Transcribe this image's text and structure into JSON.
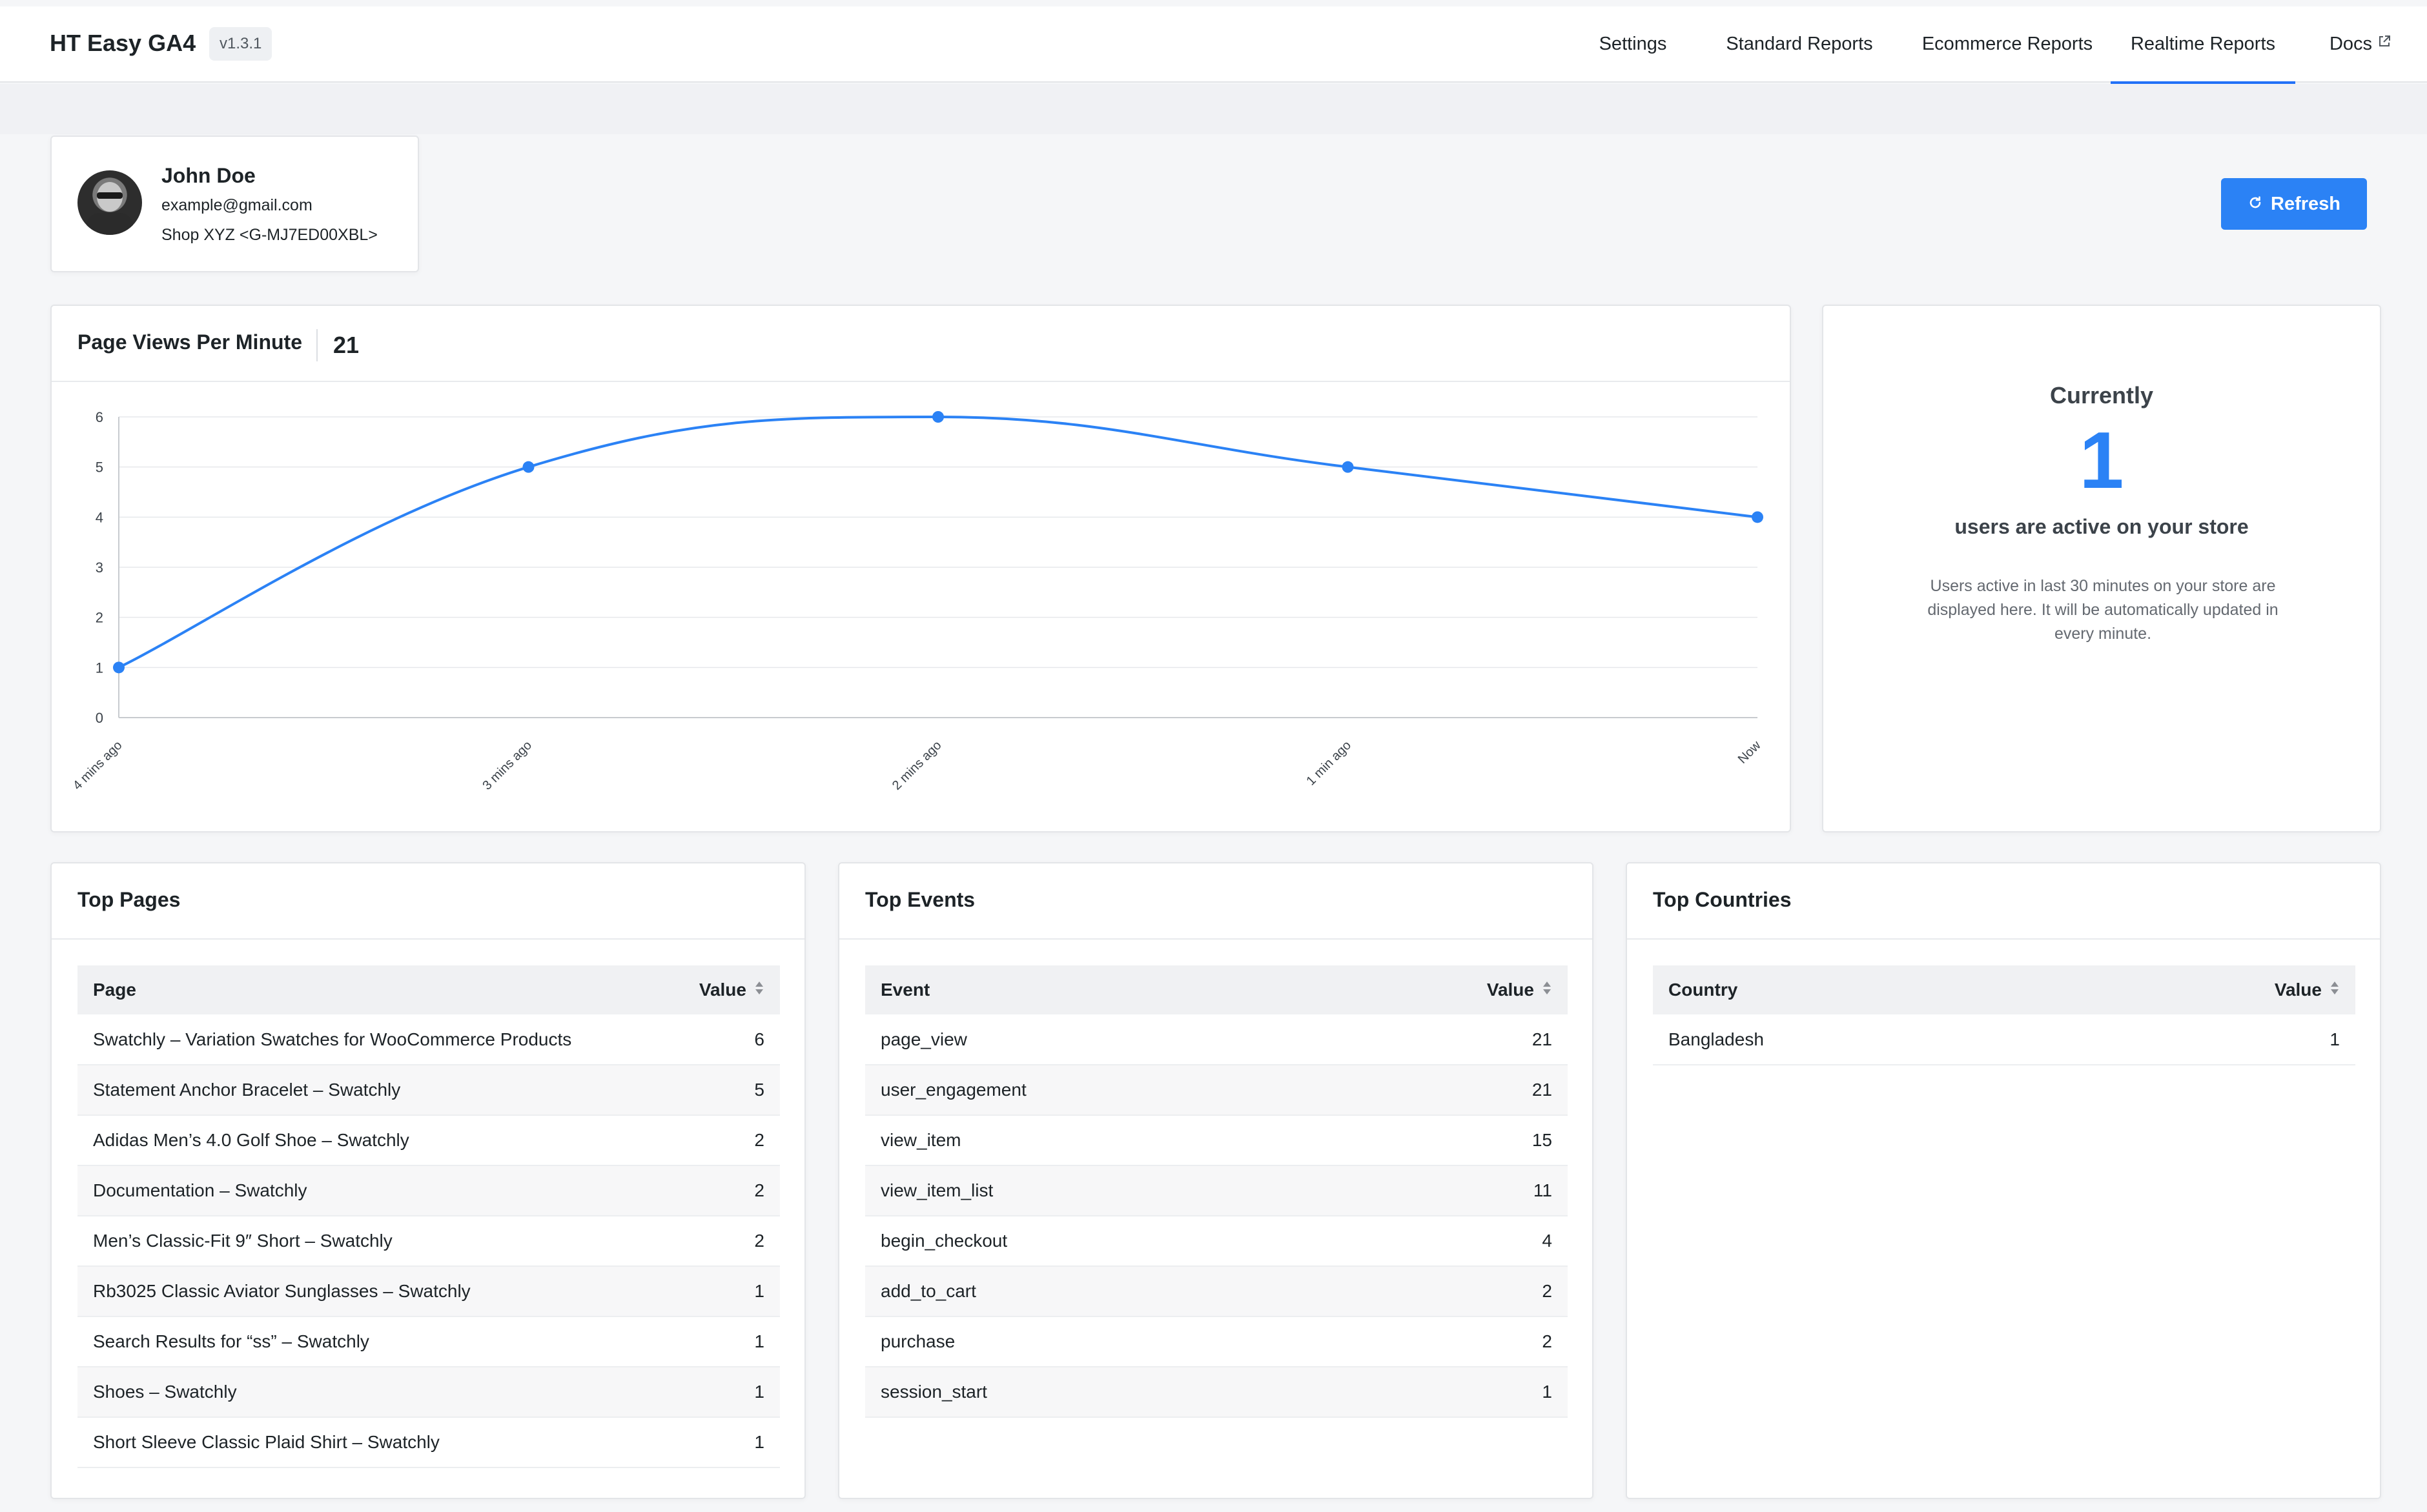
{
  "app": {
    "title": "HT Easy GA4",
    "version": "v1.3.1"
  },
  "nav": {
    "items": [
      {
        "label": "Settings"
      },
      {
        "label": "Standard Reports"
      },
      {
        "label": "Ecommerce Reports"
      },
      {
        "label": "Realtime Reports",
        "active": true
      },
      {
        "label": "Docs",
        "icon": "external-link-icon"
      }
    ]
  },
  "profile": {
    "name": "John Doe",
    "email": "example@gmail.com",
    "property": "Shop XYZ <G-MJ7ED00XBL>"
  },
  "refresh_label": "Refresh",
  "page_views": {
    "title": "Page Views Per Minute",
    "total": "21"
  },
  "active_users": {
    "heading": "Currently",
    "count": "1",
    "subtitle": "users are active on your store",
    "description": "Users active in last 30 minutes on your store are displayed here. It will be automatically updated in every minute."
  },
  "top_pages": {
    "title": "Top Pages",
    "columns": [
      "Page",
      "Value"
    ],
    "rows": [
      [
        "Swatchly – Variation Swatches for WooCommerce Products",
        "6"
      ],
      [
        "Statement Anchor Bracelet – Swatchly",
        "5"
      ],
      [
        "Adidas Men’s 4.0 Golf Shoe – Swatchly",
        "2"
      ],
      [
        "Documentation – Swatchly",
        "2"
      ],
      [
        "Men’s Classic-Fit 9″ Short – Swatchly",
        "2"
      ],
      [
        "Rb3025 Classic Aviator Sunglasses – Swatchly",
        "1"
      ],
      [
        "Search Results for “ss” – Swatchly",
        "1"
      ],
      [
        "Shoes – Swatchly",
        "1"
      ],
      [
        "Short Sleeve Classic Plaid Shirt – Swatchly",
        "1"
      ]
    ]
  },
  "top_events": {
    "title": "Top Events",
    "columns": [
      "Event",
      "Value"
    ],
    "rows": [
      [
        "page_view",
        "21"
      ],
      [
        "user_engagement",
        "21"
      ],
      [
        "view_item",
        "15"
      ],
      [
        "view_item_list",
        "11"
      ],
      [
        "begin_checkout",
        "4"
      ],
      [
        "add_to_cart",
        "2"
      ],
      [
        "purchase",
        "2"
      ],
      [
        "session_start",
        "1"
      ]
    ]
  },
  "top_countries": {
    "title": "Top Countries",
    "columns": [
      "Country",
      "Value"
    ],
    "rows": [
      [
        "Bangladesh",
        "1"
      ]
    ]
  },
  "colors": {
    "accent": "#2b82f5",
    "text": "#1d2327",
    "grid": "#e6e8eb"
  },
  "chart_data": {
    "type": "line",
    "categories": [
      "4 mins ago",
      "3 mins ago",
      "2 mins ago",
      "1 min ago",
      "Now"
    ],
    "values": [
      1,
      5,
      6,
      5,
      4
    ],
    "ylim": [
      0,
      6
    ],
    "yticks": [
      0,
      1,
      2,
      3,
      4,
      5,
      6
    ],
    "grid": true,
    "smooth": true
  }
}
